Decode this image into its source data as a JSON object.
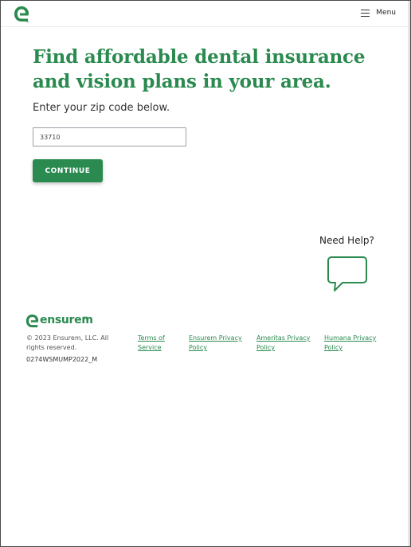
{
  "header": {
    "logo_icon": "ensurem-e-logo-icon",
    "menu_icon": "hamburger-icon",
    "menu_label": "Menu"
  },
  "hero": {
    "title": "Find affordable dental insurance and vision plans in your area.",
    "prompt": "Enter your zip code below.",
    "zip_value": "33710",
    "continue_label": "CONTINUE"
  },
  "help": {
    "label": "Need Help?",
    "icon": "chat-bubble-icon"
  },
  "footer": {
    "brand": "ensurem",
    "trademark": "TM",
    "copyright": "© 2023 Ensurem, LLC. All rights reserved.",
    "links": [
      "Terms of Service",
      "Ensurem Privacy Policy",
      "Ameritas Privacy Policy",
      "Humana Privacy Policy"
    ],
    "code": "0274WSMUMP2022_M"
  },
  "colors": {
    "brand_green": "#2a8a4f",
    "text": "#333333"
  }
}
